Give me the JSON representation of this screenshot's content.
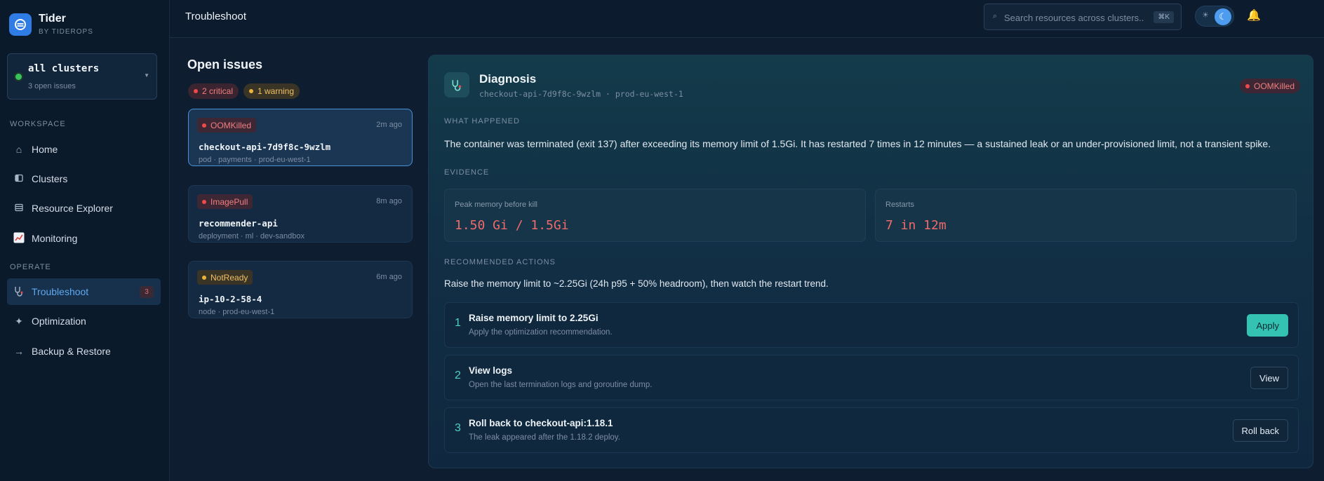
{
  "brand": {
    "name": "Tider",
    "sub": "BY TIDEROPS"
  },
  "cluster": {
    "name": "all clusters",
    "sub": "3 open issues"
  },
  "sidebar": {
    "workspace_label": "WORKSPACE",
    "operate_label": "OPERATE",
    "workspace_items": [
      {
        "label": "Home",
        "icon": "home-icon"
      },
      {
        "label": "Clusters",
        "icon": "clusters-icon"
      },
      {
        "label": "Resource Explorer",
        "icon": "list-icon"
      },
      {
        "label": "Monitoring",
        "icon": "chart-icon"
      }
    ],
    "operate_items": [
      {
        "label": "Troubleshoot",
        "icon": "stethoscope-icon",
        "badge": "3",
        "active": true
      },
      {
        "label": "Optimization",
        "icon": "sparkle-icon"
      },
      {
        "label": "Backup & Restore",
        "icon": "arrow-right-icon"
      }
    ]
  },
  "header": {
    "title": "Troubleshoot",
    "search_placeholder": "Search resources across clusters...",
    "search_value": "",
    "shortcut": "⌘K"
  },
  "issues": {
    "title": "Open issues",
    "critical_chip": "2 critical",
    "warning_chip": "1 warning",
    "items": [
      {
        "tag": "OOMKilled",
        "time": "2m ago",
        "name": "checkout-api-7d9f8c-9wzlm",
        "meta": "pod · payments · prod-eu-west-1"
      },
      {
        "tag": "ImagePull",
        "time": "8m ago",
        "name": "recommender-api",
        "meta": "deployment · ml · dev-sandbox"
      },
      {
        "tag": "NotReady",
        "time": "6m ago",
        "name": "ip-10-2-58-4",
        "meta": "node · prod-eu-west-1"
      }
    ]
  },
  "diagnosis": {
    "title": "Diagnosis",
    "subtitle": "checkout-api-7d9f8c-9wzlm · prod-eu-west-1",
    "tag": "OOMKilled",
    "what_happened_label": "WHAT HAPPENED",
    "what_happened": "The container was terminated (exit 137) after exceeding its memory limit of 1.5Gi. It has restarted 7 times in 12 minutes — a sustained leak or an under-provisioned limit, not a transient spike.",
    "evidence_label": "EVIDENCE",
    "evidence": [
      {
        "label": "Peak memory before kill",
        "value": "1.50 Gi / 1.5Gi"
      },
      {
        "label": "Restarts",
        "value": "7 in 12m"
      }
    ],
    "recommended_label": "RECOMMENDED ACTIONS",
    "recommendation": "Raise the memory limit to ~2.25Gi (24h p95 + 50% headroom), then watch the restart trend.",
    "actions": [
      {
        "num": "1",
        "title": "Raise memory limit to 2.25Gi",
        "sub": "Apply the optimization recommendation.",
        "button": "Apply"
      },
      {
        "num": "2",
        "title": "View logs",
        "sub": "Open the last termination logs and goroutine dump.",
        "button": "View"
      },
      {
        "num": "3",
        "title": "Roll back to checkout-api:1.18.1",
        "sub": "The leak appeared after the 1.18.2 deploy.",
        "button": "Roll back"
      }
    ]
  },
  "colors": {
    "accent": "#34c2b3",
    "critical": "#ee4a4a",
    "warning": "#e9b43b",
    "link": "#5ea9ee"
  }
}
